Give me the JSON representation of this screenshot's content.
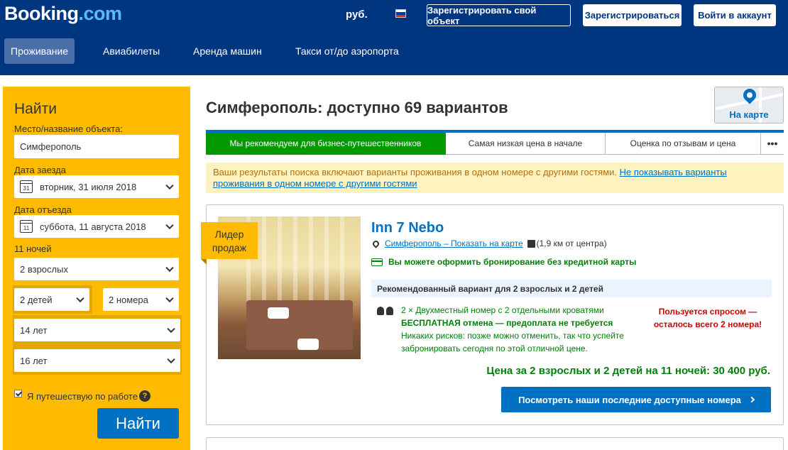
{
  "header": {
    "logo_main": "Booking",
    "logo_suffix": ".com",
    "currency": "руб.",
    "flag_colors": [
      "#ffffff",
      "#0039a6",
      "#d52b1e"
    ],
    "register_property": "Зарегистрировать свой объект",
    "register": "Зарегистрироваться",
    "login": "Войти в аккаунт",
    "nav": [
      "Проживание",
      "Авиабилеты",
      "Аренда машин",
      "Такси от/до аэропорта"
    ],
    "active_nav": "Проживание"
  },
  "search": {
    "title": "Найти",
    "destination_label": "Место/название объекта:",
    "destination_value": "Симферополь",
    "checkin_label": "Дата заезда",
    "checkin_day": "31",
    "checkin_value": "вторник, 31 июля 2018",
    "checkout_label": "Дата отъезда",
    "checkout_day": "11",
    "checkout_value": "суббота, 11 августа 2018",
    "nights": "11 ночей",
    "adults": "2 взрослых",
    "children": "2 детей",
    "rooms": "2 номера",
    "child_age_1": "14 лет",
    "child_age_2": "16 лет",
    "business_trip_label": "Я путешествую по работе",
    "business_trip_checked": true,
    "help_icon": "?",
    "submit": "Найти"
  },
  "results": {
    "title": "Симферополь: доступно 69 вариантов",
    "map_button": "На карте",
    "sort_tabs": [
      "Мы рекомендуем для бизнес-путешественников",
      "Самая низкая цена в начале",
      "Оценка по отзывам и цена"
    ],
    "sort_more": "•••",
    "notice_text": "Ваши результаты поиска включают варианты проживания в одном номере с другими гостями. ",
    "notice_link": "Не показывать варианты проживания в одном номере с другими гостями"
  },
  "hotel": {
    "badge_line1": "Лидер",
    "badge_line2": "продаж",
    "name": "Inn 7 Nebo",
    "location_link": "Симферополь – Показать на карте",
    "distance": "(1,9 км от центра)",
    "no_card": "Вы можете оформить бронирование без кредитной карты",
    "recommended": "Рекомендованный вариант для 2 взрослых и 2 детей",
    "room": "2 × Двухместный номер с 2 отдельными кроватями",
    "free_cancel": "БЕСПЛАТНАЯ отмена — предоплата не требуется",
    "no_risk": "Никаких рисков: позже можно отменить, так что успейте забронировать сегодня по этой отличной цене.",
    "demand_line1": "Пользуется спросом —",
    "demand_line2": "осталось всего 2 номера!",
    "price": "Цена за 2 взрослых и 2 детей на 11 ночей: 30 400 руб.",
    "cta": "Посмотреть наши последние доступные номера"
  }
}
